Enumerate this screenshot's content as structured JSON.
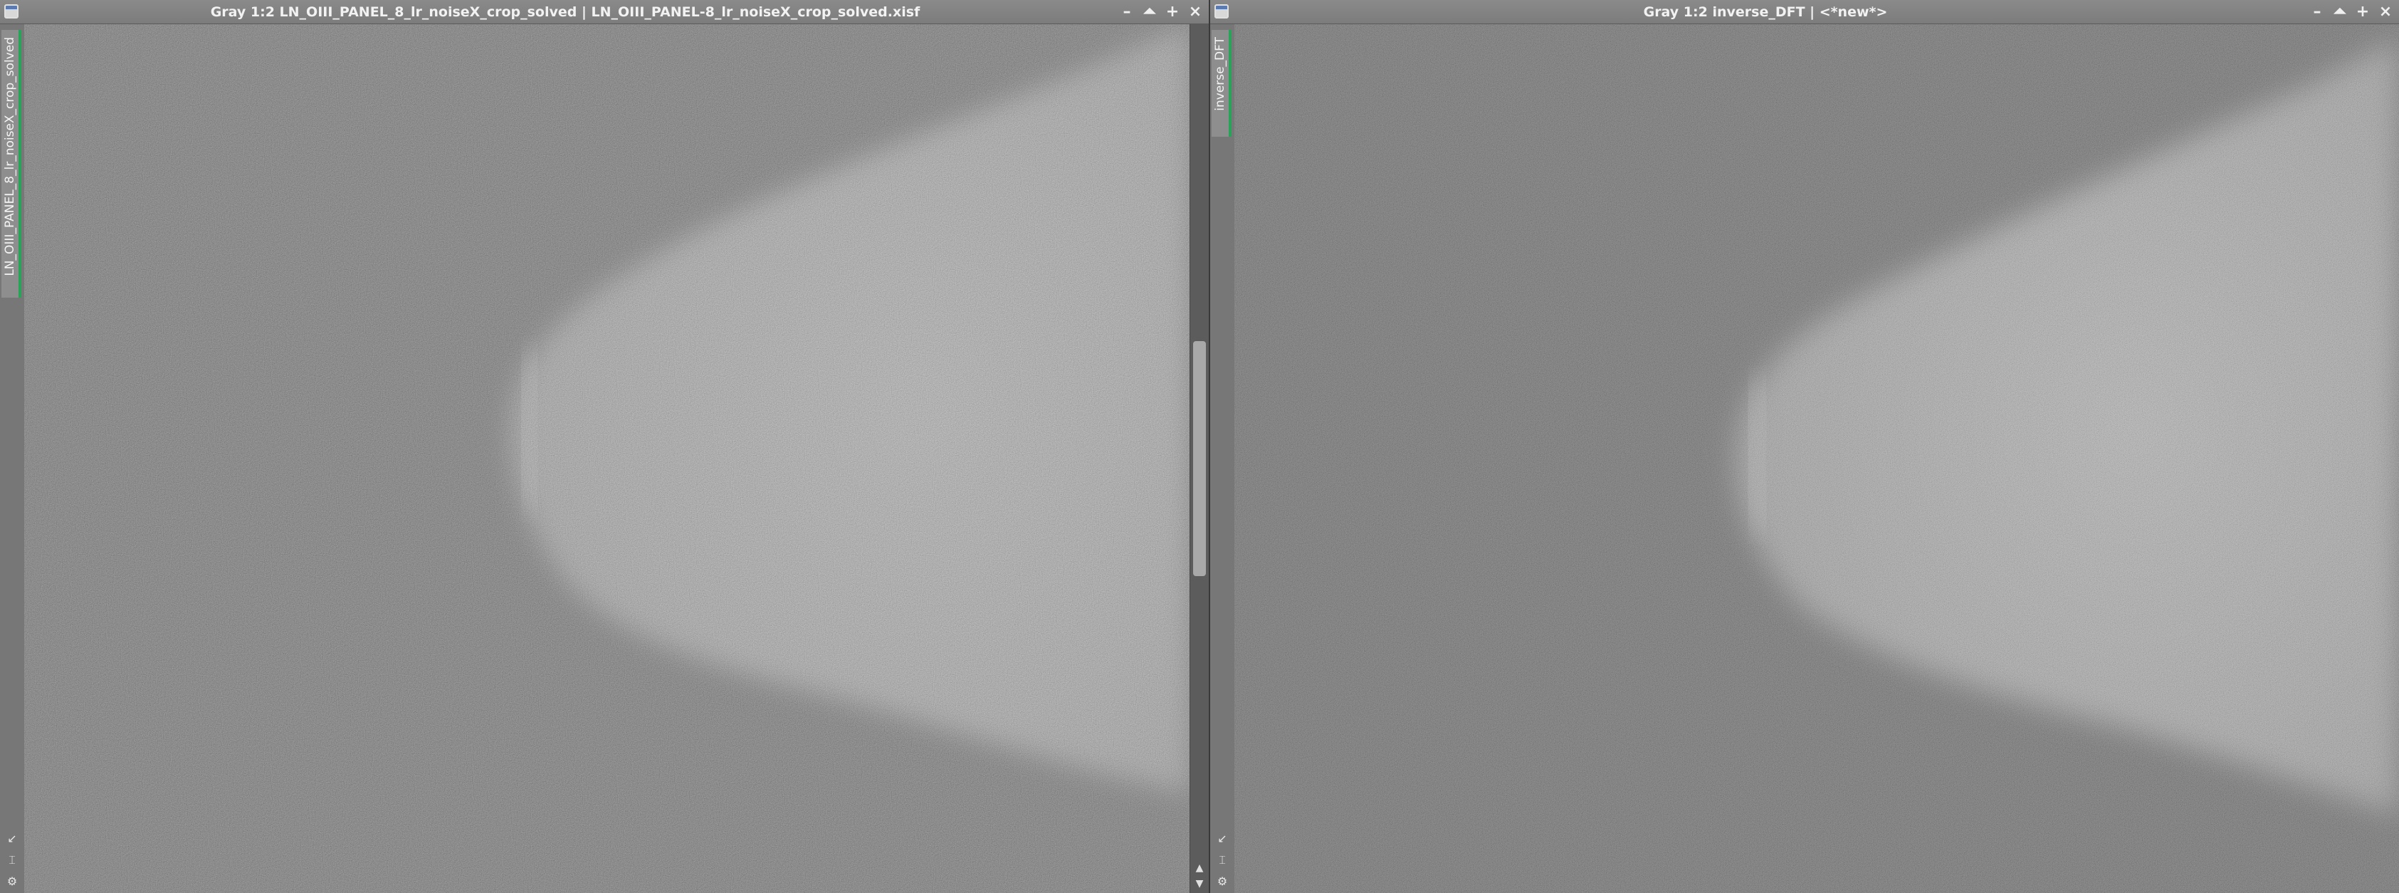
{
  "windows": [
    {
      "id": "left",
      "title": "Gray 1:2 LN_OIII_PANEL_8_lr_noiseX_crop_solved | LN_OIII_PANEL-8_lr_noiseX_crop_solved.xisf",
      "view_tab": "LN_OIII_PANEL_8_lr_noiseX_crop_solved"
    },
    {
      "id": "right",
      "title": "Gray 1:2 inverse_DFT | <*new*>",
      "view_tab": "inverse_DFT"
    }
  ],
  "controls": {
    "minimize": "–",
    "shade": "⏶",
    "maximize": "+",
    "close": "×"
  },
  "icons": {
    "window_menu": "window-menu-icon",
    "side_top": "arrow-diagonal-icon",
    "side_mid": "pin-icon",
    "side_bottom": "settings-icon"
  },
  "colors": {
    "tab_accent": "#29a35a",
    "titlebar": "#8a8a8a"
  }
}
